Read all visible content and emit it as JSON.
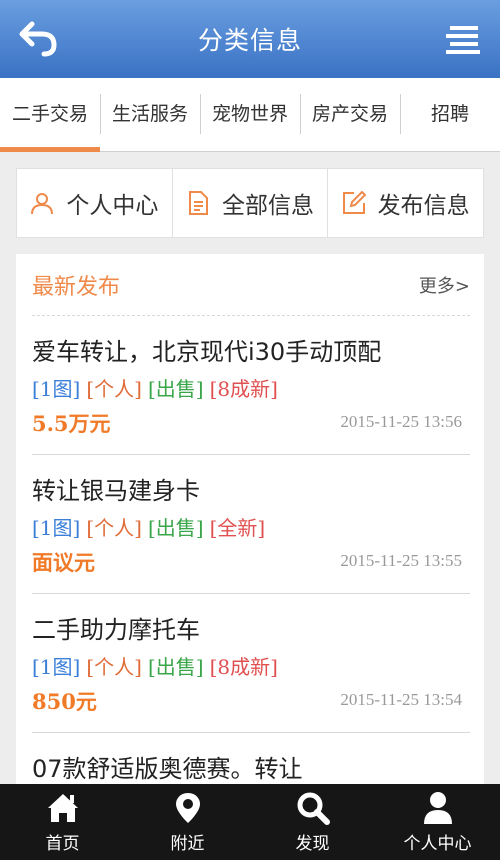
{
  "header": {
    "title": "分类信息"
  },
  "categories": [
    "二手交易",
    "生活服务",
    "宠物世界",
    "房产交易",
    "招聘"
  ],
  "quick_actions": [
    "个人中心",
    "全部信息",
    "发布信息"
  ],
  "latest": {
    "heading": "最新发布",
    "more": "更多>",
    "items": [
      {
        "title": "爱车转让，北京现代i30手动顶配",
        "tags": [
          "[1图]",
          "[个人]",
          "[出售]",
          "[8成新]"
        ],
        "price": "5.5万元",
        "date": "2015-11-25 13:56"
      },
      {
        "title": "转让银马建身卡",
        "tags": [
          "[1图]",
          "[个人]",
          "[出售]",
          "[全新]"
        ],
        "price": "面议元",
        "date": "2015-11-25 13:55"
      },
      {
        "title": "二手助力摩托车",
        "tags": [
          "[1图]",
          "[个人]",
          "[出售]",
          "[8成新]"
        ],
        "price": "850元",
        "date": "2015-11-25 13:54"
      },
      {
        "title": "07款舒适版奥德赛。转让"
      }
    ]
  },
  "bottom_nav": [
    "首页",
    "附近",
    "发现",
    "个人中心"
  ],
  "colors": {
    "header_start": "#6a9ee0",
    "header_end": "#3a72c4",
    "accent": "#f08a4b",
    "price": "#f07a28"
  }
}
